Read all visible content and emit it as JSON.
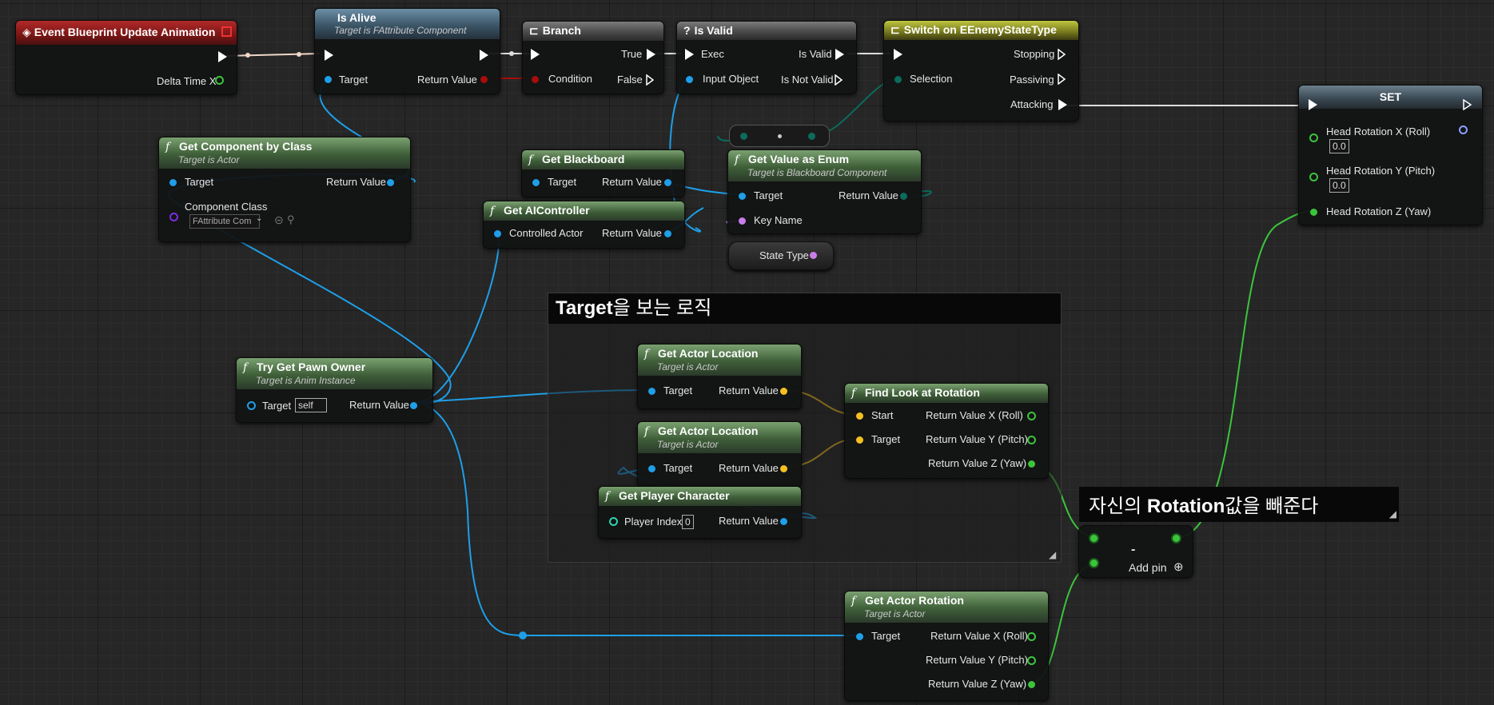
{
  "nodes": {
    "event": {
      "title": "Event Blueprint Update Animation",
      "pin_delta": "Delta Time X"
    },
    "is_alive": {
      "title": "Is Alive",
      "subtitle": "Target is FAttribute Component",
      "pin_target": "Target",
      "pin_return": "Return Value"
    },
    "branch": {
      "title": "Branch",
      "pin_true": "True",
      "pin_condition": "Condition",
      "pin_false": "False"
    },
    "is_valid": {
      "title": "Is Valid",
      "pin_exec": "Exec",
      "pin_is_valid": "Is Valid",
      "pin_input": "Input Object",
      "pin_not_valid": "Is Not Valid"
    },
    "switch": {
      "title": "Switch on EEnemyStateType",
      "pin_stopping": "Stopping",
      "pin_selection": "Selection",
      "pin_passiving": "Passiving",
      "pin_attacking": "Attacking"
    },
    "set": {
      "title": "SET",
      "pin_roll": "Head Rotation X (Roll)",
      "roll_value": "0.0",
      "pin_pitch": "Head Rotation Y (Pitch)",
      "pitch_value": "0.0",
      "pin_yaw": "Head Rotation Z (Yaw)"
    },
    "get_component": {
      "title": "Get Component by Class",
      "subtitle": "Target is Actor",
      "pin_target": "Target",
      "pin_return": "Return Value",
      "pin_class": "Component Class",
      "class_value": "FAttribute Com"
    },
    "get_blackboard": {
      "title": "Get Blackboard",
      "pin_target": "Target",
      "pin_return": "Return Value"
    },
    "get_ai": {
      "title": "Get AIController",
      "pin_actor": "Controlled Actor",
      "pin_return": "Return Value"
    },
    "get_enum": {
      "title": "Get Value as Enum",
      "subtitle": "Target is Blackboard Component",
      "pin_target": "Target",
      "pin_return": "Return Value",
      "pin_key": "Key Name"
    },
    "state_type": {
      "label": "State Type"
    },
    "try_pawn": {
      "title": "Try Get Pawn Owner",
      "subtitle": "Target is Anim Instance",
      "pin_target": "Target",
      "target_value": "self",
      "pin_return": "Return Value"
    },
    "actor_loc1": {
      "title": "Get Actor Location",
      "subtitle": "Target is Actor",
      "pin_target": "Target",
      "pin_return": "Return Value"
    },
    "actor_loc2": {
      "title": "Get Actor Location",
      "subtitle": "Target is Actor",
      "pin_target": "Target",
      "pin_return": "Return Value"
    },
    "player_char": {
      "title": "Get Player Character",
      "pin_index": "Player Index",
      "index_value": "0",
      "pin_return": "Return Value"
    },
    "look_at": {
      "title": "Find Look at Rotation",
      "pin_start": "Start",
      "pin_target": "Target",
      "pin_rx": "Return Value X (Roll)",
      "pin_ry": "Return Value Y (Pitch)",
      "pin_rz": "Return Value Z (Yaw)"
    },
    "actor_rot": {
      "title": "Get Actor Rotation",
      "subtitle": "Target is Actor",
      "pin_target": "Target",
      "pin_rx": "Return Value X (Roll)",
      "pin_ry": "Return Value Y (Pitch)",
      "pin_rz": "Return Value Z (Yaw)"
    },
    "subtract": {
      "symbol": "-",
      "add_pin": "Add pin"
    }
  },
  "comments": {
    "look_logic": {
      "title_bold": "Target",
      "title_rest": "을 보는 로직"
    },
    "subtract_note": {
      "part1": "자신의 ",
      "part_bold": "Rotation",
      "part2": "값을 빼준다"
    }
  },
  "colors": {
    "exec": "#ffffff",
    "object": "#1e9fe8",
    "bool": "#a60d0d",
    "vector": "#f5c01f",
    "float": "#3cc43c",
    "enum": "#0b6b5c",
    "name": "#c87ee6",
    "class": "#7a2ee0"
  }
}
